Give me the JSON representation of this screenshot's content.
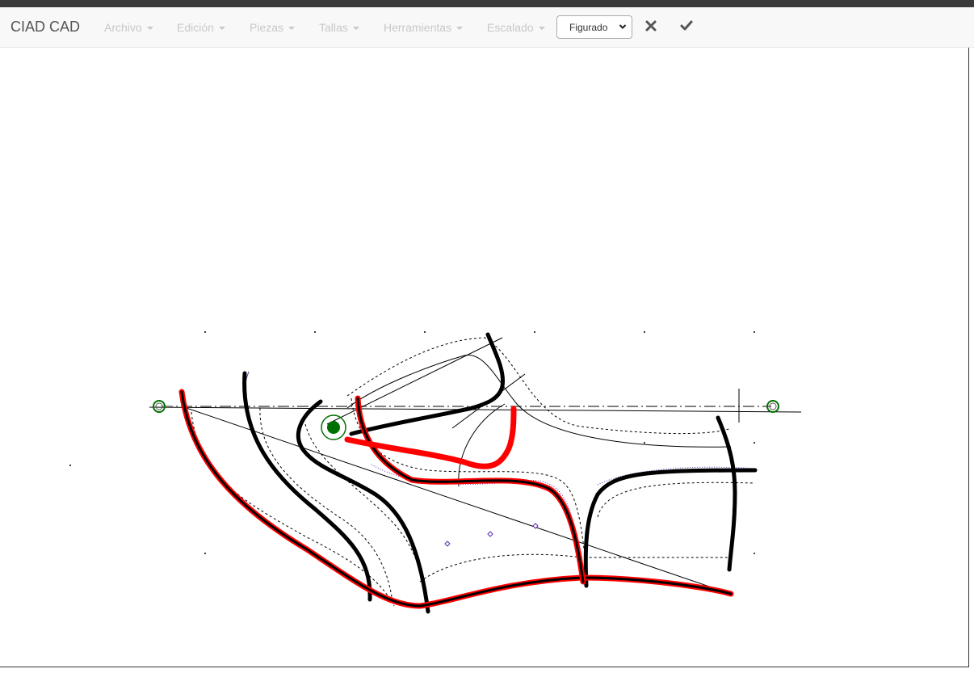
{
  "app": {
    "brand": "CIAD CAD"
  },
  "menu": {
    "archivo": "Archivo",
    "edicion": "Edición",
    "piezas": "Piezas",
    "tallas": "Tallas",
    "herramientas": "Herramientas",
    "escalado": "Escalado"
  },
  "toolbar": {
    "mode_select_value": "Figurado",
    "cancel_icon": "close-icon",
    "confirm_icon": "check-icon"
  },
  "colors": {
    "navbar_bg": "#f8f8f8",
    "menu_text_disabled": "#c8c8c8",
    "brand_text": "#555555",
    "pattern_line": "#000000",
    "selected_line": "#ff0000",
    "anchor_point": "#007000",
    "seam_allowance": "#000000",
    "guide_dash": "#808080",
    "node_marker": "#5a2bb0"
  }
}
